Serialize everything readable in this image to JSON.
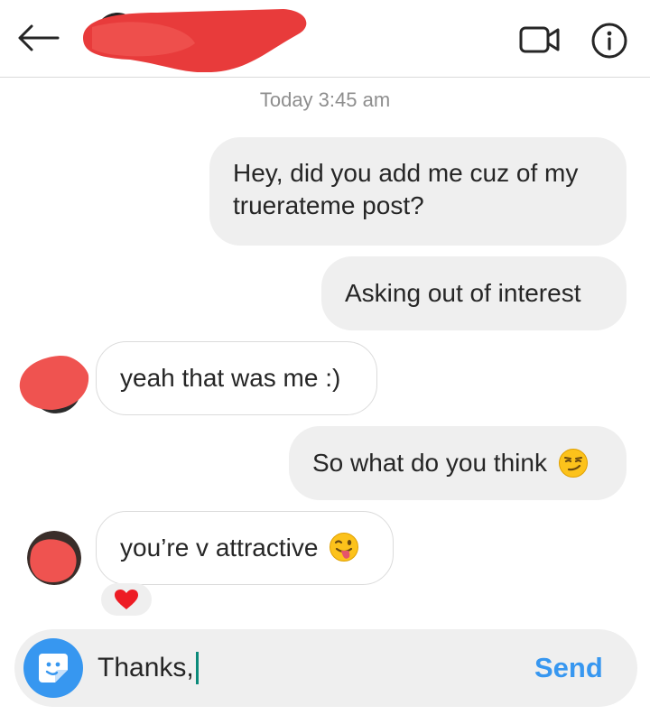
{
  "header": {
    "back_icon": "arrow-left-icon",
    "video_icon": "video-camera-icon",
    "info_icon": "info-circle-icon",
    "name_redacted": true
  },
  "thread": {
    "timestamp": "Today 3:45 am",
    "messages": [
      {
        "direction": "outgoing",
        "text": "Hey, did you add me cuz of my truerateme post?"
      },
      {
        "direction": "outgoing",
        "text": "Asking out of interest"
      },
      {
        "direction": "incoming",
        "text": "yeah that was me :)"
      },
      {
        "direction": "outgoing",
        "text": "So what do you think",
        "emoji": "smirking-face-icon"
      },
      {
        "direction": "incoming",
        "text": "you’re v attractive",
        "emoji": "winking-face-with-tongue-icon",
        "reaction": "red-heart-icon"
      }
    ]
  },
  "composer": {
    "sticker_icon": "sticker-icon",
    "input_value": "Thanks,",
    "send_label": "Send"
  },
  "colors": {
    "accent": "#3797f0",
    "outgoing_bubble": "#efefef",
    "incoming_border": "#dbdbdb",
    "timestamp_text": "#8e8e8e",
    "redaction": "#e83b3b",
    "heart": "#ed1c24",
    "caret": "#0b8a7a"
  }
}
